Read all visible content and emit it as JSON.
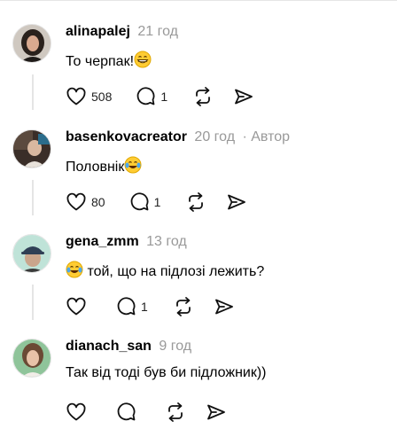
{
  "comments": [
    {
      "username": "alinapalej",
      "time": "21 год",
      "author_tag": "",
      "text": "То черпак!",
      "emoji": "grinning-face",
      "emoji_position": "after",
      "likes": "508",
      "replies": "1",
      "avatar": "woman-dark-hair"
    },
    {
      "username": "basenkovacreator",
      "time": "20 год",
      "author_tag": "· Автор",
      "text": "Половнік",
      "emoji": "tears-of-joy",
      "emoji_position": "after",
      "likes": "80",
      "replies": "1",
      "avatar": "person-photo"
    },
    {
      "username": "gena_zmm",
      "time": "13 год",
      "author_tag": "",
      "text": " той, що на підлозі лежить?",
      "emoji": "tears-of-joy",
      "emoji_position": "before",
      "likes": "",
      "replies": "1",
      "avatar": "man-cap"
    },
    {
      "username": "dianach_san",
      "time": "9 год",
      "author_tag": "",
      "text": "Так від тоді був би підложник))",
      "emoji": "",
      "emoji_position": "",
      "likes": "",
      "replies": "",
      "avatar": "woman-green-bg"
    }
  ],
  "icons": {
    "like": "heart-icon",
    "reply": "comment-icon",
    "repost": "repost-icon",
    "share": "send-icon"
  },
  "colors": {
    "muted": "#999999",
    "thread_line": "#e5e5e5"
  }
}
